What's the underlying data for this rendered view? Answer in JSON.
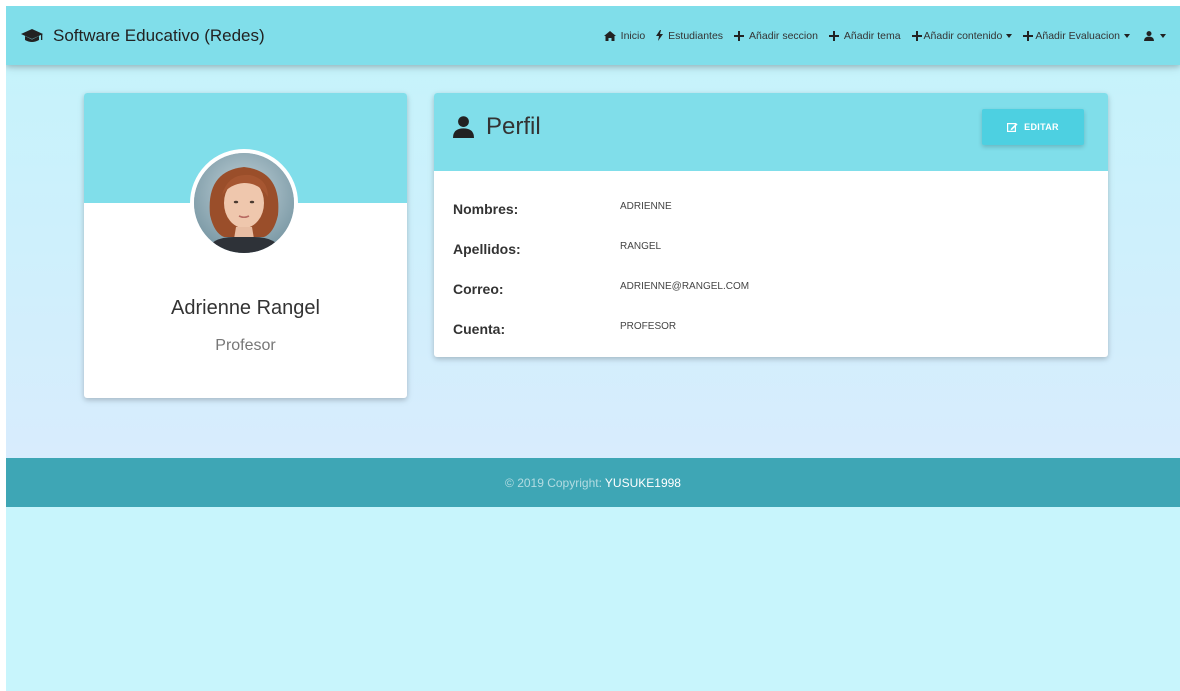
{
  "navbar": {
    "brand": "Software Educativo (Redes)",
    "brand_icon": "graduation-cap-icon",
    "items": [
      {
        "label": "Inicio",
        "icon": "home-icon"
      },
      {
        "label": "Estudiantes",
        "icon": "bolt-icon"
      },
      {
        "label": "Añadir seccion",
        "icon": "plus-icon"
      },
      {
        "label": "Añadir tema",
        "icon": "plus-icon"
      },
      {
        "label": "Añadir contenido",
        "icon": "plus-icon",
        "dropdown": true
      },
      {
        "label": "Añadir Evaluacion",
        "icon": "plus-icon",
        "dropdown": true
      }
    ],
    "user_icon": "user-icon"
  },
  "profile_card": {
    "name": "Adrienne Rangel",
    "role": "Profesor"
  },
  "details_card": {
    "title": "Perfil",
    "edit_label": "EDITAR",
    "fields": [
      {
        "label": "Nombres:",
        "value": "ADRIENNE"
      },
      {
        "label": "Apellidos:",
        "value": "RANGEL"
      },
      {
        "label": "Correo:",
        "value": "ADRIENNE@RANGEL.COM"
      },
      {
        "label": "Cuenta:",
        "value": "PROFESOR"
      }
    ]
  },
  "footer": {
    "copyright": "© 2019 Copyright:",
    "owner": "YUSUKE1998"
  },
  "colors": {
    "navbar": "#80deea",
    "background": "#c8f5fc",
    "footer": "#3ea6b5",
    "button": "#4dd0e1"
  }
}
